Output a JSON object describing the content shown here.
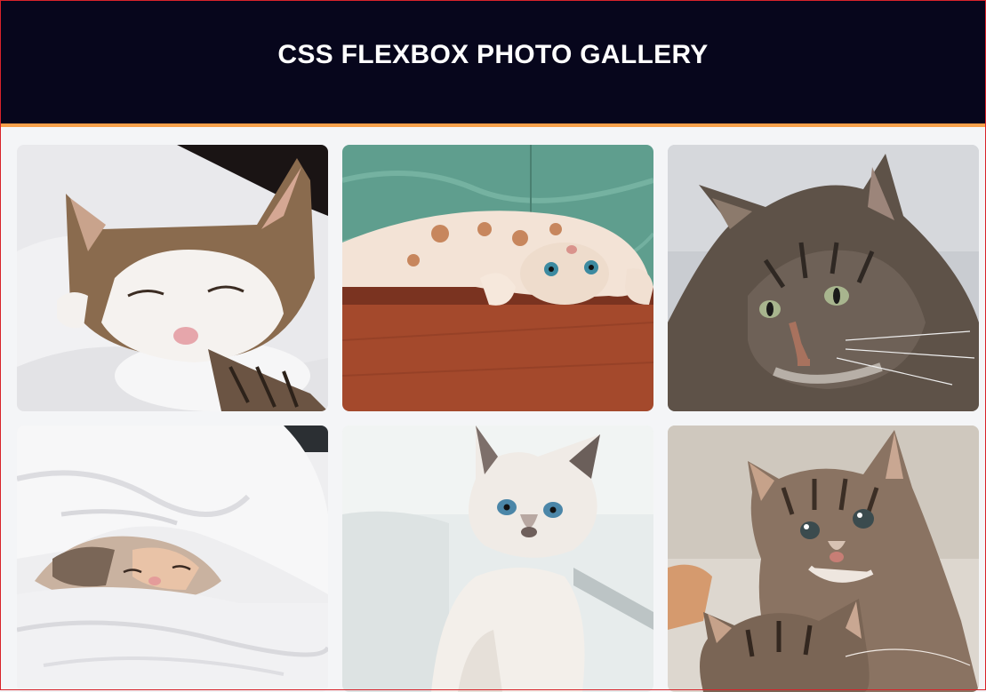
{
  "header": {
    "title": "CSS FLEXBOX PHOTO GALLERY"
  },
  "gallery": {
    "photos": [
      {
        "subject": "sleeping tabby-and-white cat on white blanket"
      },
      {
        "subject": "spotted cat lying upside down on wooden floor"
      },
      {
        "subject": "fluffy grey tabby cat portrait"
      },
      {
        "subject": "cat sleeping under white duvet"
      },
      {
        "subject": "white siamese kitten with blue eyes"
      },
      {
        "subject": "two tabby kittens"
      }
    ]
  },
  "colors": {
    "header_bg": "#07061c",
    "accent_border": "#f7a04a",
    "page_bg": "#f4f5f7"
  }
}
